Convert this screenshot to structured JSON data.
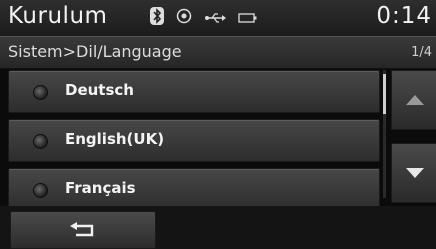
{
  "header": {
    "title": "Kurulum",
    "clock": "0:14",
    "status_icons": [
      "bluetooth-icon",
      "gps-icon",
      "usb-icon",
      "battery-icon"
    ]
  },
  "subheader": {
    "breadcrumb": "Sistem>Dil/Language",
    "page_indicator": "1/4"
  },
  "languages": [
    {
      "label": "Deutsch",
      "selected": false
    },
    {
      "label": "English(UK)",
      "selected": false
    },
    {
      "label": "Français",
      "selected": false
    }
  ],
  "controls": {
    "scroll_up_icon": "triangle-up-icon",
    "scroll_down_icon": "triangle-down-icon",
    "back_icon": "back-arrow-icon"
  },
  "colors": {
    "background": "#0b0b0b",
    "item_top": "#474747",
    "item_bottom": "#2d2d2d",
    "text": "#f4f4f4"
  }
}
